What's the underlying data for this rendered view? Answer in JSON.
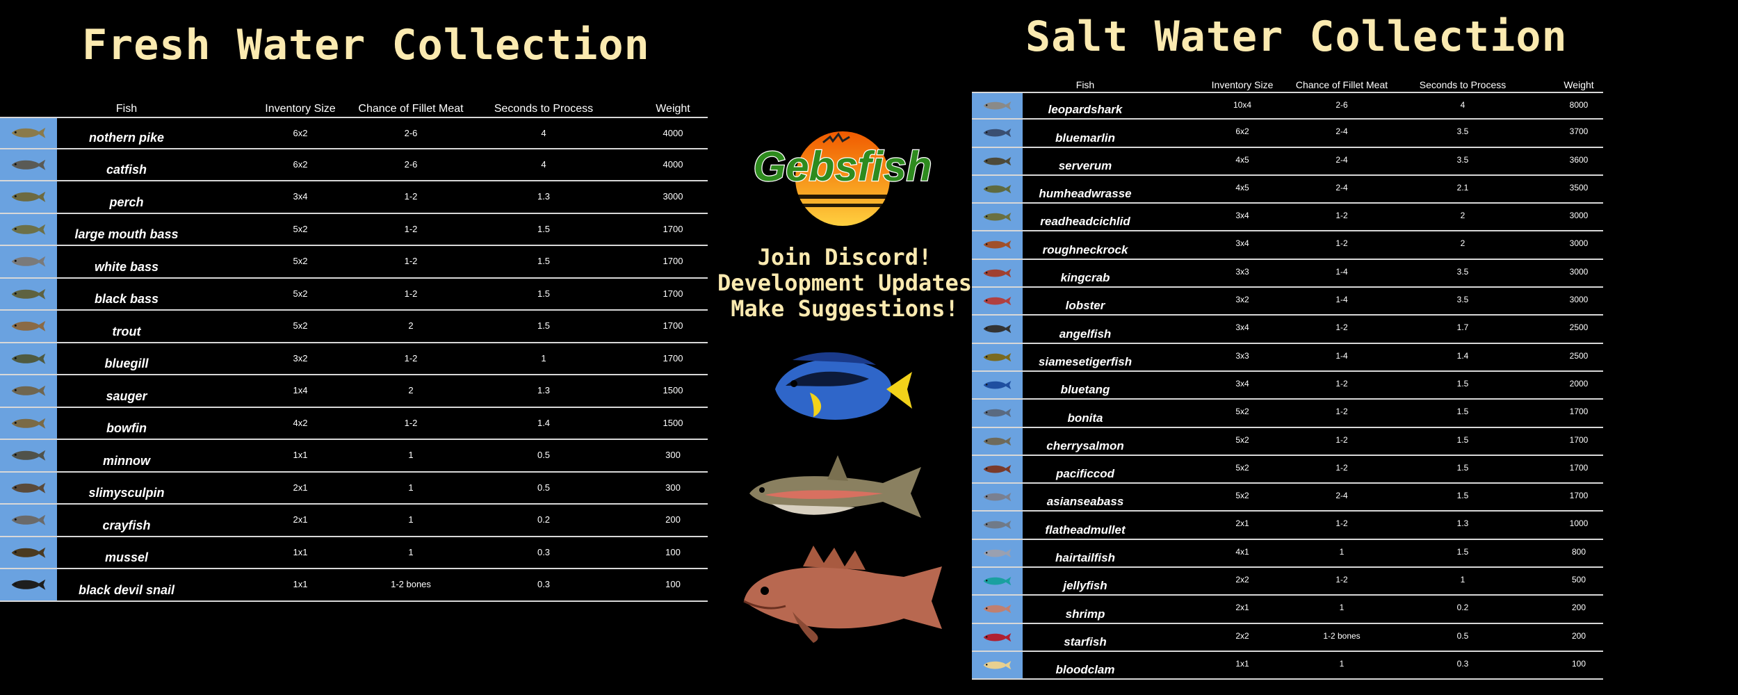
{
  "fresh": {
    "title": "Fresh Water Collection",
    "headers": {
      "fish": "Fish",
      "inv": "Inventory Size",
      "fillet": "Chance of Fillet Meat",
      "seconds": "Seconds to Process",
      "weight": "Weight"
    },
    "rows": [
      {
        "name": "nothern pike",
        "inv": "6x2",
        "fillet": "2-6",
        "seconds": "4",
        "weight": "4000",
        "icon": "pike-icon",
        "color": "#8a7a4a"
      },
      {
        "name": "catfish",
        "inv": "6x2",
        "fillet": "2-6",
        "seconds": "4",
        "weight": "4000",
        "icon": "catfish-icon",
        "color": "#5a5a55"
      },
      {
        "name": "perch",
        "inv": "3x4",
        "fillet": "1-2",
        "seconds": "1.3",
        "weight": "3000",
        "icon": "perch-icon",
        "color": "#6d6a40"
      },
      {
        "name": "large mouth bass",
        "inv": "5x2",
        "fillet": "1-2",
        "seconds": "1.5",
        "weight": "1700",
        "icon": "largemouth-bass-icon",
        "color": "#6c7048"
      },
      {
        "name": "white bass",
        "inv": "5x2",
        "fillet": "1-2",
        "seconds": "1.5",
        "weight": "1700",
        "icon": "white-bass-icon",
        "color": "#7a7a7a"
      },
      {
        "name": "black bass",
        "inv": "5x2",
        "fillet": "1-2",
        "seconds": "1.5",
        "weight": "1700",
        "icon": "black-bass-icon",
        "color": "#5e6240"
      },
      {
        "name": "trout",
        "inv": "5x2",
        "fillet": "2",
        "seconds": "1.5",
        "weight": "1700",
        "icon": "trout-icon",
        "color": "#8a6a45"
      },
      {
        "name": "bluegill",
        "inv": "3x2",
        "fillet": "1-2",
        "seconds": "1",
        "weight": "1700",
        "icon": "bluegill-icon",
        "color": "#4f5a40"
      },
      {
        "name": "sauger",
        "inv": "1x4",
        "fillet": "2",
        "seconds": "1.3",
        "weight": "1500",
        "icon": "sauger-icon",
        "color": "#6f6650"
      },
      {
        "name": "bowfin",
        "inv": "4x2",
        "fillet": "1-2",
        "seconds": "1.4",
        "weight": "1500",
        "icon": "bowfin-icon",
        "color": "#7a6a45"
      },
      {
        "name": "minnow",
        "inv": "1x1",
        "fillet": "1",
        "seconds": "0.5",
        "weight": "300",
        "icon": "minnow-icon",
        "color": "#50524a"
      },
      {
        "name": "slimysculpin",
        "inv": "2x1",
        "fillet": "1",
        "seconds": "0.5",
        "weight": "300",
        "icon": "sculpin-icon",
        "color": "#5a4a3a"
      },
      {
        "name": "crayfish",
        "inv": "2x1",
        "fillet": "1",
        "seconds": "0.2",
        "weight": "200",
        "icon": "crayfish-icon",
        "color": "#6a6a6a"
      },
      {
        "name": "mussel",
        "inv": "1x1",
        "fillet": "1",
        "seconds": "0.3",
        "weight": "100",
        "icon": "mussel-icon",
        "color": "#4a3a20"
      },
      {
        "name": "black devil snail",
        "inv": "1x1",
        "fillet": "1-2 bones",
        "seconds": "0.3",
        "weight": "100",
        "icon": "snail-icon",
        "color": "#1e1e1e"
      }
    ]
  },
  "salt": {
    "title": "Salt Water Collection",
    "headers": {
      "fish": "Fish",
      "inv": "Inventory Size",
      "fillet": "Chance of Fillet Meat",
      "seconds": "Seconds to Process",
      "weight": "Weight"
    },
    "rows": [
      {
        "name": "leopardshark",
        "inv": "10x4",
        "fillet": "2-6",
        "seconds": "4",
        "weight": "8000",
        "icon": "leopard-shark-icon",
        "color": "#8a8a88"
      },
      {
        "name": "bluemarlin",
        "inv": "6x2",
        "fillet": "2-4",
        "seconds": "3.5",
        "weight": "3700",
        "icon": "blue-marlin-icon",
        "color": "#3a4e70"
      },
      {
        "name": "serverum",
        "inv": "4x5",
        "fillet": "2-4",
        "seconds": "3.5",
        "weight": "3600",
        "icon": "serverum-icon",
        "color": "#4d4a3a"
      },
      {
        "name": "humheadwrasse",
        "inv": "4x5",
        "fillet": "2-4",
        "seconds": "2.1",
        "weight": "3500",
        "icon": "humphead-wrasse-icon",
        "color": "#5e6a40"
      },
      {
        "name": "readheadcichlid",
        "inv": "3x4",
        "fillet": "1-2",
        "seconds": "2",
        "weight": "3000",
        "icon": "redhead-cichlid-icon",
        "color": "#6a7040"
      },
      {
        "name": "roughneckrock",
        "inv": "3x4",
        "fillet": "1-2",
        "seconds": "2",
        "weight": "3000",
        "icon": "roughneck-rockfish-icon",
        "color": "#a0502a"
      },
      {
        "name": "kingcrab",
        "inv": "3x3",
        "fillet": "1-4",
        "seconds": "3.5",
        "weight": "3000",
        "icon": "king-crab-icon",
        "color": "#a04030"
      },
      {
        "name": "lobster",
        "inv": "3x2",
        "fillet": "1-4",
        "seconds": "3.5",
        "weight": "3000",
        "icon": "lobster-icon",
        "color": "#b04040"
      },
      {
        "name": "angelfish",
        "inv": "3x4",
        "fillet": "1-2",
        "seconds": "1.7",
        "weight": "2500",
        "icon": "angelfish-icon",
        "color": "#333333"
      },
      {
        "name": "siamesetigerfish",
        "inv": "3x3",
        "fillet": "1-4",
        "seconds": "1.4",
        "weight": "2500",
        "icon": "siamese-tigerfish-icon",
        "color": "#7a6a20"
      },
      {
        "name": "bluetang",
        "inv": "3x4",
        "fillet": "1-2",
        "seconds": "1.5",
        "weight": "2000",
        "icon": "blue-tang-icon",
        "color": "#1f4fa0"
      },
      {
        "name": "bonita",
        "inv": "5x2",
        "fillet": "1-2",
        "seconds": "1.5",
        "weight": "1700",
        "icon": "bonita-icon",
        "color": "#5a6a80"
      },
      {
        "name": "cherrysalmon",
        "inv": "5x2",
        "fillet": "1-2",
        "seconds": "1.5",
        "weight": "1700",
        "icon": "cherry-salmon-icon",
        "color": "#6e6a5a"
      },
      {
        "name": "pacificcod",
        "inv": "5x2",
        "fillet": "1-2",
        "seconds": "1.5",
        "weight": "1700",
        "icon": "pacific-cod-icon",
        "color": "#7a3a2a"
      },
      {
        "name": "asianseabass",
        "inv": "5x2",
        "fillet": "2-4",
        "seconds": "1.5",
        "weight": "1700",
        "icon": "asian-seabass-icon",
        "color": "#7a8090"
      },
      {
        "name": "flatheadmullet",
        "inv": "2x1",
        "fillet": "1-2",
        "seconds": "1.3",
        "weight": "1000",
        "icon": "flathead-mullet-icon",
        "color": "#707a88"
      },
      {
        "name": "hairtailfish",
        "inv": "4x1",
        "fillet": "1",
        "seconds": "1.5",
        "weight": "800",
        "icon": "hairtail-icon",
        "color": "#9aa0b0"
      },
      {
        "name": "jellyfish",
        "inv": "2x2",
        "fillet": "1-2",
        "seconds": "1",
        "weight": "500",
        "icon": "jellyfish-icon",
        "color": "#1aa0a0"
      },
      {
        "name": "shrimp",
        "inv": "2x1",
        "fillet": "1",
        "seconds": "0.2",
        "weight": "200",
        "icon": "shrimp-icon",
        "color": "#c08070"
      },
      {
        "name": "starfish",
        "inv": "2x2",
        "fillet": "1-2 bones",
        "seconds": "0.5",
        "weight": "200",
        "icon": "starfish-icon",
        "color": "#b02030"
      },
      {
        "name": "bloodclam",
        "inv": "1x1",
        "fillet": "1",
        "seconds": "0.3",
        "weight": "100",
        "icon": "blood-clam-icon",
        "color": "#e8d090"
      }
    ]
  },
  "promo": {
    "logo_text": "Gebsfish",
    "lines": [
      "Join Discord!",
      "Development Updates",
      "Make Suggestions!"
    ]
  },
  "showcase": [
    {
      "icon": "blue-tang-showcase-icon"
    },
    {
      "icon": "trout-showcase-icon"
    },
    {
      "icon": "rockfish-showcase-icon"
    }
  ],
  "colors": {
    "title": "#fbeab0",
    "icon_cell": "#6aa2e0",
    "logo_green": "#2e8b1e",
    "logo_orange": "#f08a10",
    "background": "#000000"
  }
}
